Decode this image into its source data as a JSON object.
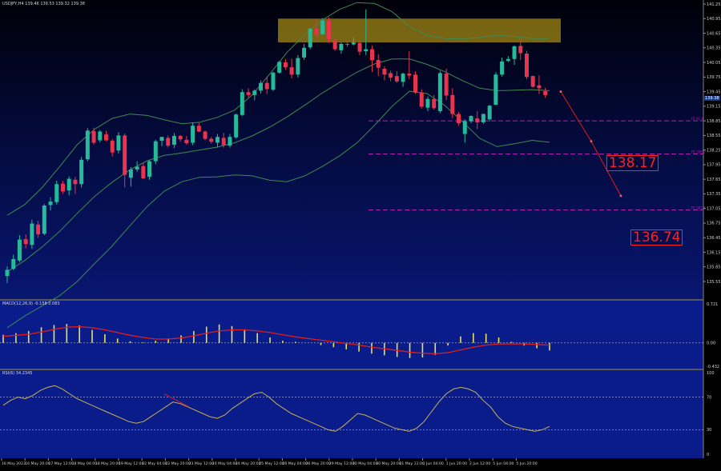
{
  "chart": {
    "info_text": "USDJPY,H4  139.46 139.53 139.32 139.38",
    "current_price": "139.38"
  },
  "main_panel": {
    "y_ticks": [
      "141.25",
      "140.95",
      "140.65",
      "140.35",
      "140.05",
      "139.75",
      "139.45",
      "139.15",
      "138.85",
      "138.55",
      "138.25",
      "137.95",
      "137.65",
      "137.35",
      "137.05",
      "136.75",
      "136.45",
      "136.15",
      "135.85",
      "135.55"
    ],
    "fib_labels": [
      "FE 61.8",
      "FE 100.0",
      "FE 161.8"
    ],
    "targets": [
      "138.17",
      "136.74"
    ]
  },
  "macd_panel": {
    "title": "MACD(12,26,9) -0.158 0.083",
    "y_ticks": [
      "0.721",
      "0.00",
      "-0.432"
    ]
  },
  "rsi_panel": {
    "title": "RSI(6) 34.2345",
    "y_ticks": [
      "100",
      "70",
      "30",
      "0"
    ]
  },
  "x_axis": {
    "labels": [
      "16 May 2023",
      "16 May 20:00",
      "17 May 12:00",
      "18 May 04:00",
      "18 May 20:00",
      "19 May 12:00",
      "22 May 04:00",
      "22 May 20:00",
      "23 May 12:00",
      "24 May 04:00",
      "24 May 20:00",
      "25 May 12:00",
      "26 May 04:00",
      "26 May 20:00",
      "29 May 12:00",
      "30 May 04:00",
      "30 May 20:00",
      "31 May 12:00",
      "1 Jun 04:00",
      "1 Jun 20:00",
      "2 Jun 12:00",
      "5 Jun 04:00",
      "5 Jun 20:00"
    ]
  },
  "colors": {
    "bull": "#26b99a",
    "bear": "#e8344e",
    "bands": "#3f8a52",
    "macd_signal": "#e11d1d",
    "histogram": "#e8e060",
    "rsi": "#c8b44a",
    "fib": "#b020b0",
    "supply_zone": "#c8a814"
  },
  "chart_data": {
    "type": "candlestick",
    "timeframe": "H4",
    "ylim": [
      135.55,
      141.25
    ],
    "ohlc": [
      [
        135.66,
        135.86,
        135.52,
        135.79
      ],
      [
        135.81,
        136.1,
        135.78,
        136.01
      ],
      [
        135.98,
        136.5,
        135.95,
        136.41
      ],
      [
        136.42,
        136.52,
        136.23,
        136.32
      ],
      [
        136.3,
        136.82,
        136.22,
        136.74
      ],
      [
        136.72,
        136.8,
        136.45,
        136.52
      ],
      [
        136.53,
        137.14,
        136.5,
        137.11
      ],
      [
        137.12,
        137.28,
        137.01,
        137.19
      ],
      [
        137.18,
        137.62,
        137.13,
        137.55
      ],
      [
        137.56,
        137.62,
        137.35,
        137.4
      ],
      [
        137.42,
        137.71,
        137.32,
        137.66
      ],
      [
        137.64,
        137.7,
        137.35,
        137.55
      ],
      [
        137.55,
        138.11,
        137.48,
        138.05
      ],
      [
        138.06,
        138.7,
        138.02,
        138.65
      ],
      [
        138.64,
        138.71,
        138.36,
        138.4
      ],
      [
        138.45,
        138.66,
        138.41,
        138.63
      ],
      [
        138.57,
        138.65,
        138.43,
        138.45
      ],
      [
        138.44,
        138.48,
        138.12,
        138.2
      ],
      [
        138.24,
        138.62,
        138.18,
        138.55
      ],
      [
        138.55,
        138.59,
        137.48,
        137.74
      ],
      [
        137.68,
        137.9,
        137.5,
        137.85
      ],
      [
        137.85,
        138.02,
        137.8,
        137.91
      ],
      [
        137.92,
        137.98,
        137.65,
        137.67
      ],
      [
        137.7,
        138.04,
        137.64,
        138.02
      ],
      [
        138.02,
        138.46,
        137.96,
        138.43
      ],
      [
        138.44,
        138.52,
        138.33,
        138.52
      ],
      [
        138.5,
        138.55,
        138.3,
        138.34
      ],
      [
        138.36,
        138.6,
        138.29,
        138.54
      ],
      [
        138.54,
        138.56,
        138.42,
        138.47
      ],
      [
        138.46,
        138.54,
        138.36,
        138.39
      ],
      [
        138.4,
        138.82,
        138.35,
        138.75
      ],
      [
        138.75,
        138.82,
        138.62,
        138.63
      ],
      [
        138.63,
        138.65,
        138.45,
        138.48
      ],
      [
        138.48,
        138.52,
        138.38,
        138.42
      ],
      [
        138.4,
        138.58,
        138.3,
        138.52
      ],
      [
        138.5,
        138.6,
        138.3,
        138.35
      ],
      [
        138.34,
        138.58,
        138.3,
        138.52
      ],
      [
        138.51,
        139.0,
        138.48,
        138.98
      ],
      [
        138.97,
        139.5,
        138.95,
        139.44
      ],
      [
        139.44,
        139.52,
        139.33,
        139.38
      ],
      [
        139.38,
        139.5,
        139.27,
        139.47
      ],
      [
        139.47,
        139.68,
        139.41,
        139.63
      ],
      [
        139.63,
        139.76,
        139.4,
        139.5
      ],
      [
        139.49,
        139.86,
        139.46,
        139.84
      ],
      [
        139.84,
        140.08,
        139.82,
        140.06
      ],
      [
        140.05,
        140.12,
        139.9,
        139.95
      ],
      [
        139.95,
        140.13,
        139.72,
        139.8
      ],
      [
        139.8,
        140.2,
        139.74,
        140.14
      ],
      [
        140.15,
        140.43,
        140.1,
        140.35
      ],
      [
        140.36,
        140.76,
        140.32,
        140.74
      ],
      [
        140.74,
        140.93,
        140.55,
        140.63
      ],
      [
        140.63,
        140.96,
        140.61,
        140.91
      ],
      [
        140.9,
        140.98,
        140.45,
        140.53
      ],
      [
        140.5,
        140.55,
        140.29,
        140.32
      ],
      [
        140.3,
        140.46,
        140.23,
        140.43
      ],
      [
        140.43,
        140.5,
        140.37,
        140.42
      ],
      [
        140.42,
        140.56,
        140.4,
        140.46
      ],
      [
        140.45,
        140.5,
        140.2,
        140.27
      ],
      [
        140.28,
        141.14,
        140.2,
        140.32
      ],
      [
        140.32,
        140.4,
        139.85,
        140.1
      ],
      [
        140.1,
        140.22,
        139.77,
        139.94
      ],
      [
        139.92,
        139.97,
        139.68,
        139.8
      ],
      [
        139.83,
        139.88,
        139.66,
        139.74
      ],
      [
        139.77,
        139.87,
        139.63,
        139.66
      ],
      [
        139.65,
        139.84,
        139.55,
        139.82
      ],
      [
        139.82,
        140.28,
        139.71,
        139.78
      ],
      [
        139.8,
        139.87,
        139.4,
        139.43
      ],
      [
        139.43,
        139.5,
        139.1,
        139.14
      ],
      [
        139.12,
        139.35,
        139.05,
        139.3
      ],
      [
        139.3,
        139.38,
        139.08,
        139.11
      ],
      [
        139.05,
        139.88,
        139.01,
        139.83
      ],
      [
        139.82,
        139.92,
        139.28,
        139.37
      ],
      [
        139.38,
        139.52,
        138.9,
        138.99
      ],
      [
        138.99,
        139.03,
        138.75,
        138.8
      ],
      [
        138.58,
        138.88,
        138.4,
        138.84
      ],
      [
        138.84,
        138.96,
        138.8,
        138.95
      ],
      [
        138.9,
        139.05,
        138.68,
        138.82
      ],
      [
        138.82,
        139.0,
        138.79,
        138.99
      ],
      [
        138.88,
        139.18,
        138.84,
        139.16
      ],
      [
        139.18,
        139.85,
        139.17,
        139.8
      ],
      [
        139.8,
        140.15,
        139.76,
        140.07
      ],
      [
        140.08,
        140.18,
        140.06,
        140.12
      ],
      [
        140.12,
        140.4,
        140.0,
        140.38
      ],
      [
        140.39,
        140.55,
        140.1,
        140.24
      ],
      [
        140.23,
        140.29,
        139.71,
        139.75
      ],
      [
        139.77,
        139.78,
        139.53,
        139.55
      ],
      [
        139.58,
        139.78,
        139.4,
        139.52
      ],
      [
        139.46,
        139.53,
        139.32,
        139.38
      ]
    ],
    "bollinger_upper": [
      136.91,
      137.13,
      137.48,
      137.91,
      138.36,
      138.68,
      138.9,
      138.99,
      138.96,
      138.87,
      138.79,
      138.82,
      138.92,
      139.07,
      139.38,
      139.81,
      140.26,
      140.62,
      140.92,
      141.14,
      141.28,
      141.26,
      141.09,
      140.79,
      140.61,
      140.54,
      140.53,
      140.56,
      140.61,
      140.58,
      140.54,
      140.54
    ],
    "bollinger_middle": [
      135.75,
      135.98,
      136.26,
      136.58,
      136.95,
      137.3,
      137.59,
      137.84,
      138.03,
      138.14,
      138.19,
      138.25,
      138.31,
      138.4,
      138.54,
      138.72,
      138.93,
      139.17,
      139.42,
      139.64,
      139.85,
      140.02,
      140.12,
      140.12,
      140.01,
      139.86,
      139.68,
      139.52,
      139.47,
      139.48,
      139.49,
      139.47
    ],
    "bollinger_lower": [
      134.6,
      134.84,
      135.05,
      135.26,
      135.55,
      135.92,
      136.28,
      136.69,
      137.09,
      137.41,
      137.6,
      137.69,
      137.7,
      137.74,
      137.72,
      137.63,
      137.6,
      137.72,
      137.91,
      138.13,
      138.4,
      138.76,
      139.15,
      139.46,
      139.41,
      139.17,
      138.84,
      138.49,
      138.32,
      138.38,
      138.45,
      138.41
    ],
    "supply_zone": {
      "y_top": 140.95,
      "y_bottom": 140.46
    },
    "fibonacci_extension": {
      "FE 61.8": 138.85,
      "FE 100.0": 138.17,
      "FE 161.8": 137.02
    },
    "projection_path": [
      139.45,
      138.43,
      137.31
    ],
    "macd": {
      "histogram": [
        0.15,
        0.18,
        0.22,
        0.29,
        0.33,
        0.35,
        0.32,
        0.24,
        0.16,
        0.08,
        0.03,
        0.01,
        0.04,
        0.08,
        0.14,
        0.22,
        0.3,
        0.34,
        0.31,
        0.25,
        0.18,
        0.1,
        0.04,
        0.02,
        0.0,
        -0.04,
        -0.08,
        -0.12,
        -0.16,
        -0.2,
        -0.23,
        -0.26,
        -0.28,
        -0.27,
        -0.22,
        -0.05,
        0.12,
        0.18,
        0.17,
        0.1,
        0.02,
        -0.05,
        -0.1,
        -0.14
      ],
      "signal": [
        0.12,
        0.14,
        0.16,
        0.2,
        0.25,
        0.29,
        0.3,
        0.28,
        0.24,
        0.19,
        0.14,
        0.1,
        0.07,
        0.07,
        0.09,
        0.13,
        0.18,
        0.22,
        0.24,
        0.24,
        0.22,
        0.19,
        0.15,
        0.11,
        0.08,
        0.05,
        0.02,
        -0.01,
        -0.04,
        -0.08,
        -0.11,
        -0.14,
        -0.17,
        -0.19,
        -0.2,
        -0.18,
        -0.13,
        -0.08,
        -0.04,
        -0.02,
        -0.02,
        -0.02,
        -0.03,
        -0.04
      ],
      "ylim": [
        -0.432,
        0.721
      ]
    },
    "rsi": {
      "values": [
        60,
        66,
        70,
        68,
        72,
        78,
        82,
        84,
        80,
        74,
        68,
        64,
        60,
        56,
        52,
        48,
        44,
        40,
        38,
        40,
        46,
        52,
        58,
        64,
        62,
        58,
        54,
        50,
        46,
        44,
        48,
        56,
        62,
        68,
        74,
        76,
        70,
        62,
        56,
        50,
        46,
        42,
        38,
        34,
        30,
        28,
        34,
        42,
        50,
        48,
        44,
        40,
        36,
        32,
        30,
        28,
        32,
        40,
        52,
        64,
        74,
        80,
        82,
        80,
        76,
        66,
        58,
        46,
        38,
        34,
        32,
        30,
        28,
        30,
        34
      ],
      "ylim": [
        0,
        100
      ],
      "levels": [
        70,
        30
      ]
    }
  }
}
